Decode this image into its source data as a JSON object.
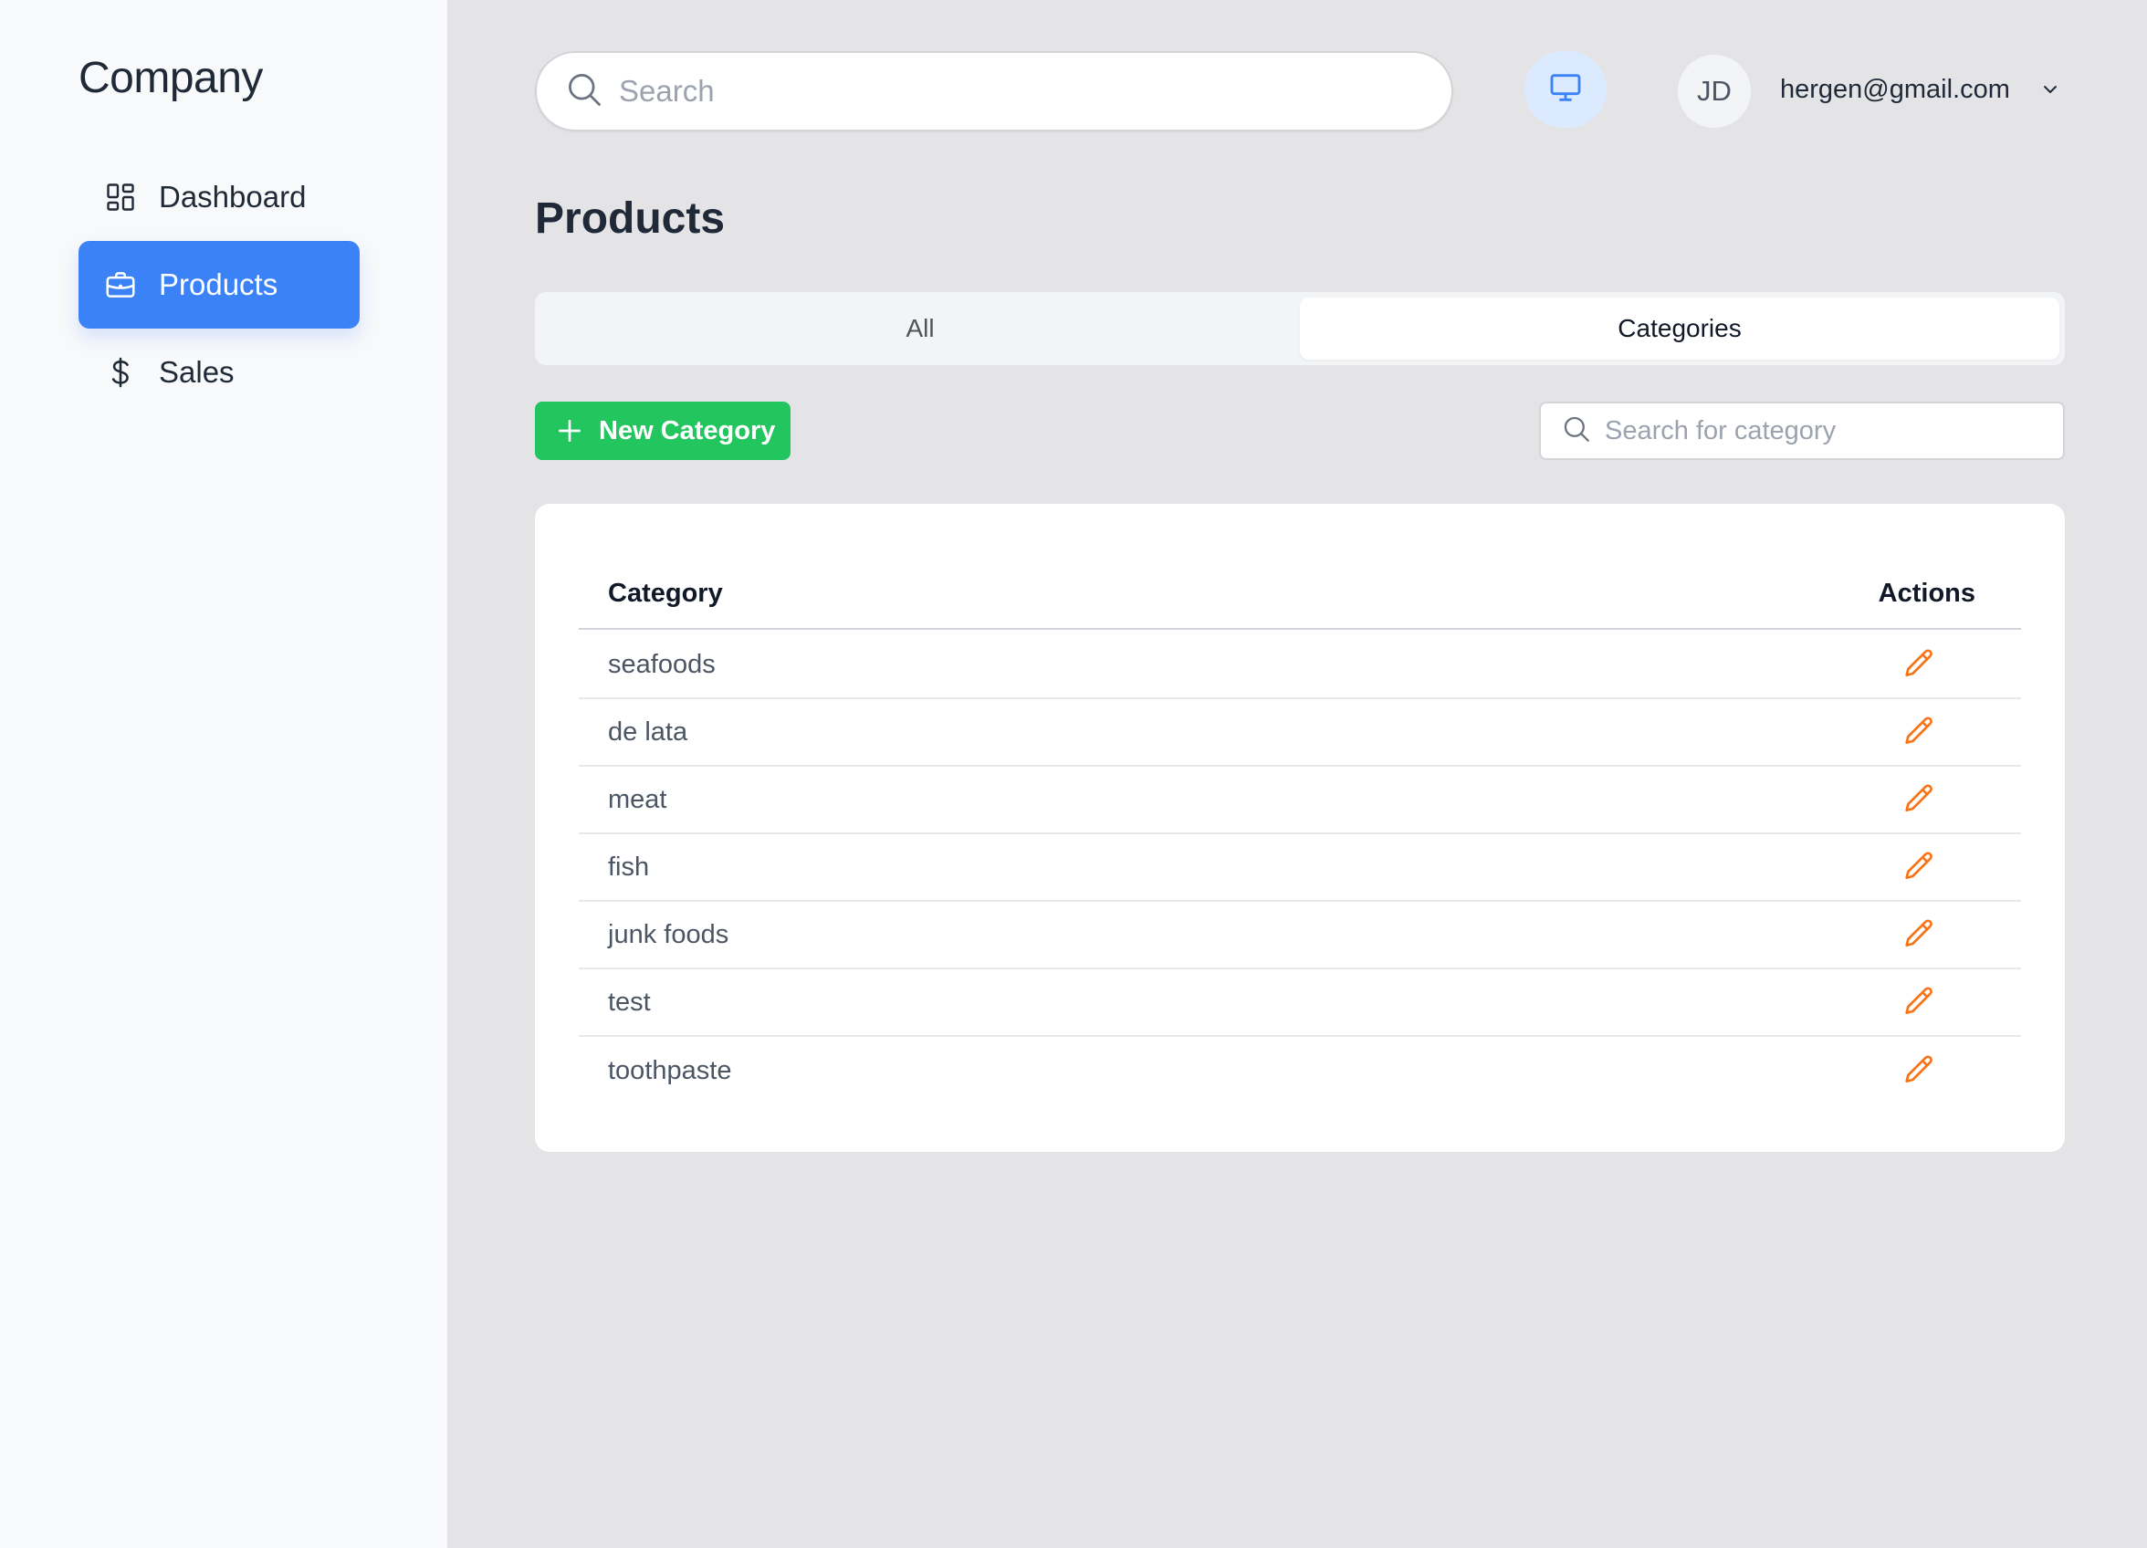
{
  "sidebar": {
    "brand": "Company",
    "items": [
      {
        "label": "Dashboard",
        "icon": "dashboard-icon"
      },
      {
        "label": "Products",
        "icon": "briefcase-icon",
        "active": true
      },
      {
        "label": "Sales",
        "icon": "dollar-icon"
      }
    ]
  },
  "header": {
    "search_placeholder": "Search",
    "monitor_icon": "monitor-icon",
    "avatar_initials": "JD",
    "user_email": "hergen@gmail.com"
  },
  "main": {
    "title": "Products",
    "tabs": [
      {
        "label": "All",
        "active": false
      },
      {
        "label": "Categories",
        "active": true
      }
    ],
    "new_button_label": "New Category",
    "category_search_placeholder": "Search for category",
    "table": {
      "headers": [
        "Category",
        "Actions"
      ],
      "rows": [
        "seafoods",
        "de lata",
        "meat",
        "fish",
        "junk foods",
        "test",
        "toothpaste"
      ]
    }
  },
  "colors": {
    "accent": "#3b82f6",
    "success": "#22c55e",
    "edit": "#f97316"
  }
}
